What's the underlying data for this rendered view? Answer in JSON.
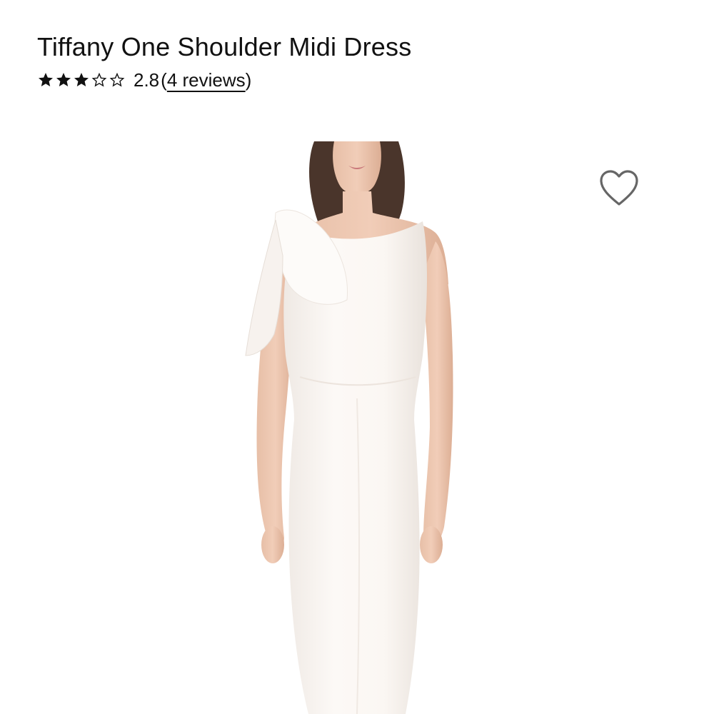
{
  "product": {
    "title": "Tiffany One Shoulder Midi Dress",
    "rating": {
      "value": "2.8",
      "stars_filled": 3,
      "stars_total": 5,
      "open_paren": "(",
      "reviews_label": "4 reviews",
      "close_paren": ")"
    },
    "image": {
      "alt": "Woman wearing white one shoulder midi dress with bow"
    },
    "wishlist_icon": "heart-outline-icon"
  },
  "colors": {
    "text": "#111111",
    "dress": "#fbf7f3",
    "background": "#ffffff",
    "icon": "#666666"
  }
}
